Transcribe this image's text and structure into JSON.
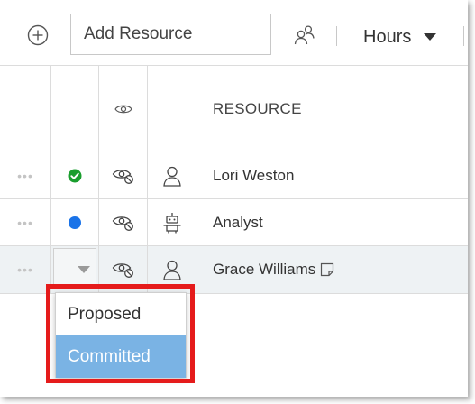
{
  "toolbar": {
    "add_icon": "plus-circle-icon",
    "search_placeholder": "Add Resource",
    "people_icon": "people-icon",
    "units_label": "Hours"
  },
  "grid": {
    "columns": [
      {
        "key": "drag",
        "label": ""
      },
      {
        "key": "status",
        "label": ""
      },
      {
        "key": "visibility",
        "label": "",
        "icon": "eye-icon"
      },
      {
        "key": "type",
        "label": ""
      },
      {
        "key": "resource",
        "label": "RESOURCE"
      }
    ],
    "rows": [
      {
        "handle": "•••",
        "status": "committed",
        "status_icon": "check-circle-icon",
        "visibility_icon": "eye-hidden-icon",
        "type_icon": "person-icon",
        "name": "Lori Weston"
      },
      {
        "handle": "•••",
        "status": "proposed",
        "status_icon": "blue-dot-icon",
        "visibility_icon": "eye-hidden-icon",
        "type_icon": "robot-icon",
        "name": "Analyst"
      },
      {
        "handle": "•••",
        "status": "open-dropdown",
        "status_icon": "chevron-down-icon",
        "visibility_icon": "eye-hidden-icon",
        "type_icon": "person-icon",
        "name": "Grace Williams",
        "extra_icon": "note-icon"
      }
    ]
  },
  "status_menu": {
    "options": [
      "Proposed",
      "Committed"
    ],
    "selected": "Committed"
  },
  "colors": {
    "committed_green": "#1a9e2e",
    "proposed_blue": "#1a73e8",
    "menu_selected": "#7ab3e4",
    "annotation_red": "#e51b1b"
  }
}
